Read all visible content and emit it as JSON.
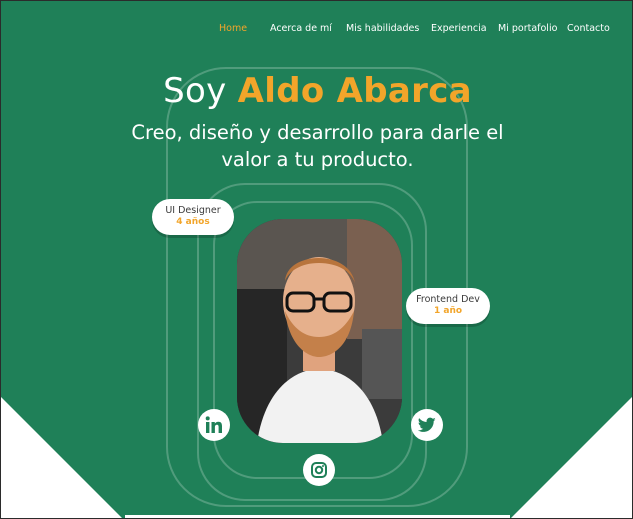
{
  "nav": {
    "items": [
      {
        "label": "Home",
        "active": true
      },
      {
        "label": "Acerca de mí",
        "active": false
      },
      {
        "label": "Mis habilidades",
        "active": false
      },
      {
        "label": "Experiencia",
        "active": false
      },
      {
        "label": "Mi portafolio",
        "active": false
      },
      {
        "label": "Contacto",
        "active": false
      }
    ]
  },
  "hero": {
    "greeting": "Soy",
    "name": "Aldo Abarca",
    "subtitle": "Creo, diseño y desarrollo para darle el valor a tu producto."
  },
  "badges": [
    {
      "role": "UI Designer",
      "years": "4 años"
    },
    {
      "role": "Frontend Dev",
      "years": "1 año"
    }
  ],
  "social": {
    "icons": [
      "linkedin-icon",
      "twitter-icon",
      "instagram-icon"
    ]
  },
  "colors": {
    "background": "#1f8058",
    "accent": "#f2a52a",
    "white": "#ffffff"
  }
}
